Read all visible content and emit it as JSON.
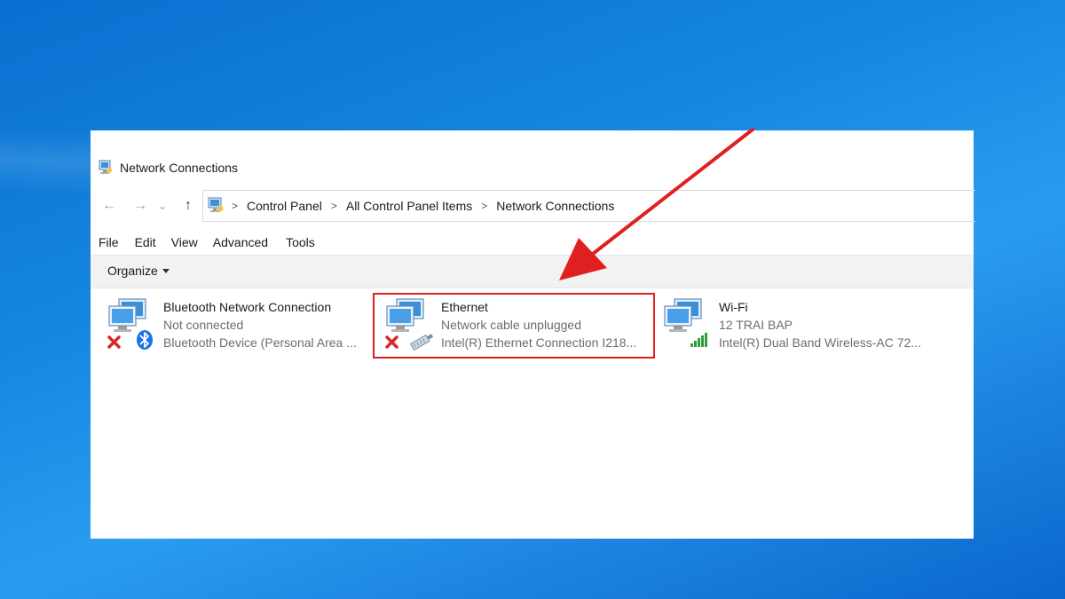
{
  "window": {
    "title": "Network Connections"
  },
  "navigation": {
    "back_glyph": "←",
    "forward_glyph": "→",
    "recent_glyph": "⌄",
    "up_glyph": "↑"
  },
  "address": {
    "crumbs": [
      "Control Panel",
      "All Control Panel Items",
      "Network Connections"
    ],
    "separator": ">"
  },
  "menu": {
    "items": [
      "File",
      "Edit",
      "View",
      "Advanced",
      "Tools"
    ]
  },
  "command_bar": {
    "organize_label": "Organize"
  },
  "connections": [
    {
      "name": "Bluetooth Network Connection",
      "status": "Not connected",
      "device": "Bluetooth Device (Personal Area ...",
      "icon": "bluetooth-network-icon"
    },
    {
      "name": "Ethernet",
      "status": "Network cable unplugged",
      "device": "Intel(R) Ethernet Connection I218...",
      "icon": "ethernet-network-icon"
    },
    {
      "name": "Wi-Fi",
      "status": "12 TRAI BAP",
      "device": "Intel(R) Dual Band Wireless-AC 72...",
      "icon": "wifi-network-icon"
    }
  ],
  "colors": {
    "highlight": "#e02020",
    "arrow": "#e02020",
    "disconnected_x": "#d42a2a",
    "bluetooth": "#1a73e8",
    "wifi_bars": "#2e9e3a"
  }
}
